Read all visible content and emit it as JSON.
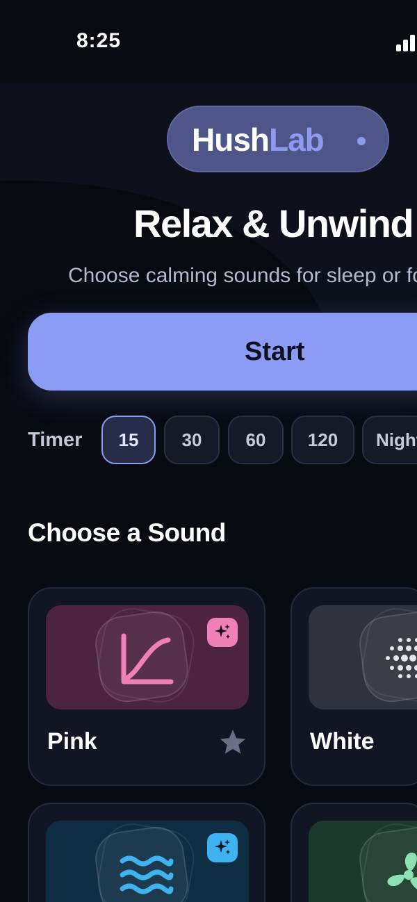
{
  "status_bar": {
    "time": "8:25",
    "signal_icon": "cellular-signal-icon"
  },
  "brand": {
    "name_part1": "Hush",
    "name_part2": "Lab",
    "accent": "#8f99f0"
  },
  "hero": {
    "title": "Relax & Unwind",
    "subtitle": "Choose calming sounds for sleep or focus"
  },
  "start_button": {
    "label": "Start",
    "color": "#8c9cf5"
  },
  "timer": {
    "label": "Timer",
    "options": [
      "15",
      "30",
      "60",
      "120",
      "Night"
    ],
    "selected": "15"
  },
  "sounds_section": {
    "title": "Choose a Sound",
    "cards": [
      {
        "name": "Pink",
        "icon": "pink-noise-curve-icon",
        "color": "#f080b8",
        "badge_icon": "sparkle-icon",
        "favorite_icon": "star-icon"
      },
      {
        "name": "White",
        "icon": "white-noise-dots-icon",
        "color": "#e6e6ea"
      },
      {
        "name": "",
        "icon": "waves-icon",
        "color": "#3fb2f0",
        "badge_icon": "sparkle-icon"
      },
      {
        "name": "",
        "icon": "fan-icon",
        "color": "#8ee0b0"
      }
    ]
  }
}
